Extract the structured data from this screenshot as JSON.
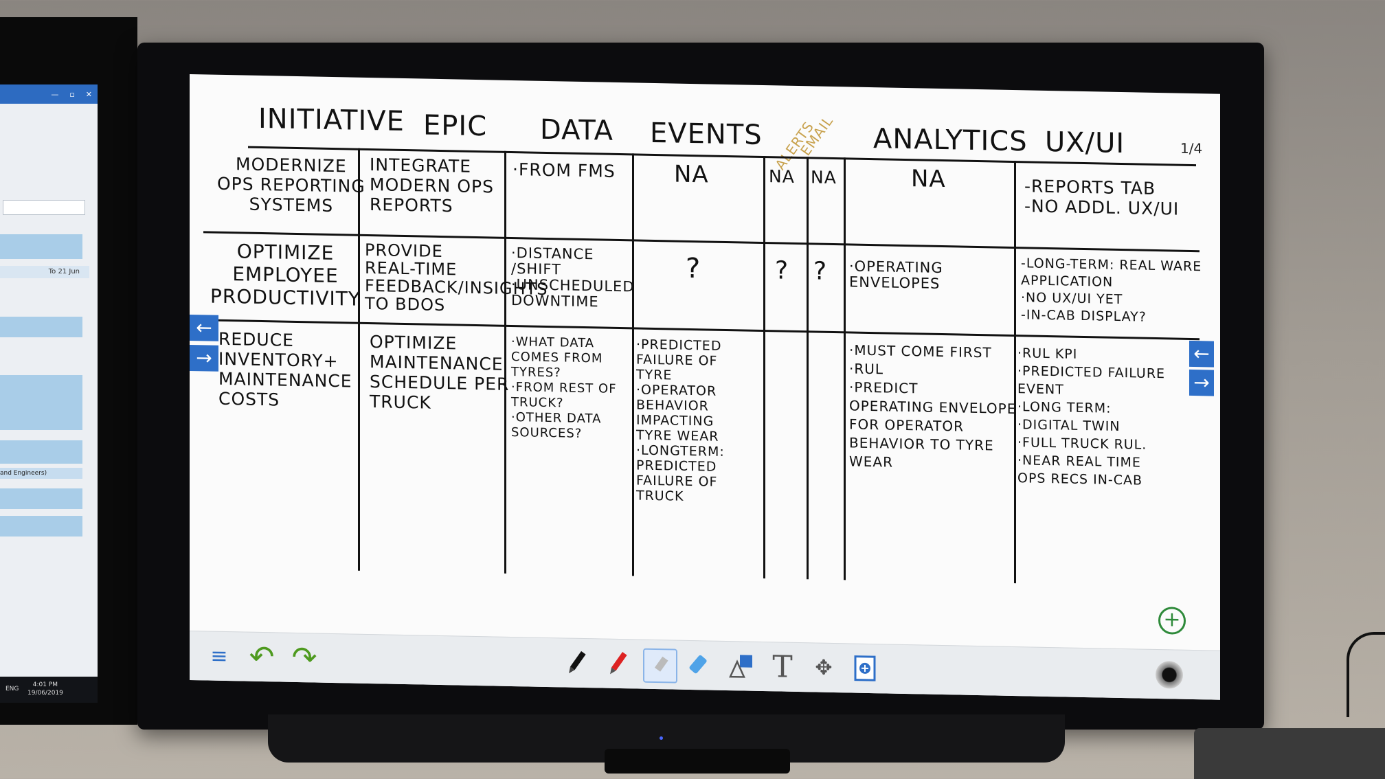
{
  "left_window": {
    "date_label": "To 21 Jun",
    "engineer_label": "and Engineers)",
    "taskbar_language": "ENG",
    "taskbar_time": "4:01 PM",
    "taskbar_date": "19/06/2019"
  },
  "whiteboard": {
    "page_indicator": "1/4",
    "headers": {
      "initiative": "INITIATIVE",
      "epic": "EPIC",
      "data": "DATA",
      "events": "EVENTS",
      "alerts": "ALERTS",
      "email": "EMAIL",
      "analytics": "ANALYTICS",
      "uxui": "UX/UI"
    },
    "rows": [
      {
        "initiative": "MODERNIZE\nOPS REPORTING\nSYSTEMS",
        "epic": "INTEGRATE\nMODERN OPS\nREPORTS",
        "data": "·FROM FMS",
        "events": "NA",
        "alerts": "NA",
        "email": "NA",
        "analytics": "NA",
        "uxui": "-REPORTS TAB\n-NO ADDL. UX/UI"
      },
      {
        "initiative": "OPTIMIZE\nEMPLOYEE\nPRODUCTIVITY",
        "epic": "PROVIDE\nREAL-TIME\nFEEDBACK/INSIGHTS\nTO BDOS",
        "data": "·DISTANCE\n/SHIFT\n·UNSCHEDULED\nDOWNTIME",
        "events": "?",
        "alerts": "?",
        "email": "?",
        "analytics": "·OPERATING\nENVELOPES",
        "uxui": "-LONG-TERM: REAL WARE\nAPPLICATION\n·NO UX/UI YET\n-IN-CAB DISPLAY?"
      },
      {
        "initiative": "REDUCE\nINVENTORY+\nMAINTENANCE\nCOSTS",
        "epic": "OPTIMIZE\nMAINTENANCE\nSCHEDULE PER\nTRUCK",
        "data": "·WHAT DATA\nCOMES FROM\nTYRES?\n·FROM REST OF\nTRUCK?\n·OTHER DATA\nSOURCES?",
        "events": "·PREDICTED\nFAILURE OF\nTYRE\n·OPERATOR\nBEHAVIOR\nIMPACTING\nTYRE WEAR\n·LONGTERM:\nPREDICTED\nFAILURE OF\nTRUCK",
        "alerts": "",
        "email": "",
        "analytics": "·MUST COME FIRST\n·RUL\n·PREDICT\nOPERATING ENVELOPE\nFOR OPERATOR\nBEHAVIOR TO TYRE\nWEAR",
        "uxui": "·RUL KPI\n·PREDICTED FAILURE\nEVENT\n·LONG TERM:\n·DIGITAL TWIN\n·FULL TRUCK RUL.\n·NEAR REAL TIME\nOPS RECS IN-CAB"
      }
    ],
    "nav": {
      "prev_arrow": "←",
      "next_arrow": "→",
      "add_page": "+"
    }
  },
  "toolbar": {
    "menu": "≡",
    "undo": "↶",
    "redo": "↷",
    "text_tool": "T",
    "move_tool": "✥",
    "icons": [
      "menu-icon",
      "undo-icon",
      "redo-icon",
      "pen-black-icon",
      "pen-red-icon",
      "highlighter-icon",
      "eraser-icon",
      "shapes-icon",
      "text-icon",
      "move-icon",
      "insert-page-icon",
      "record-icon"
    ]
  },
  "colors": {
    "accent_blue": "#2e6fc8",
    "undo_green": "#4e9a1f",
    "alerts_ink": "#c8a24e",
    "ink": "#111111"
  }
}
